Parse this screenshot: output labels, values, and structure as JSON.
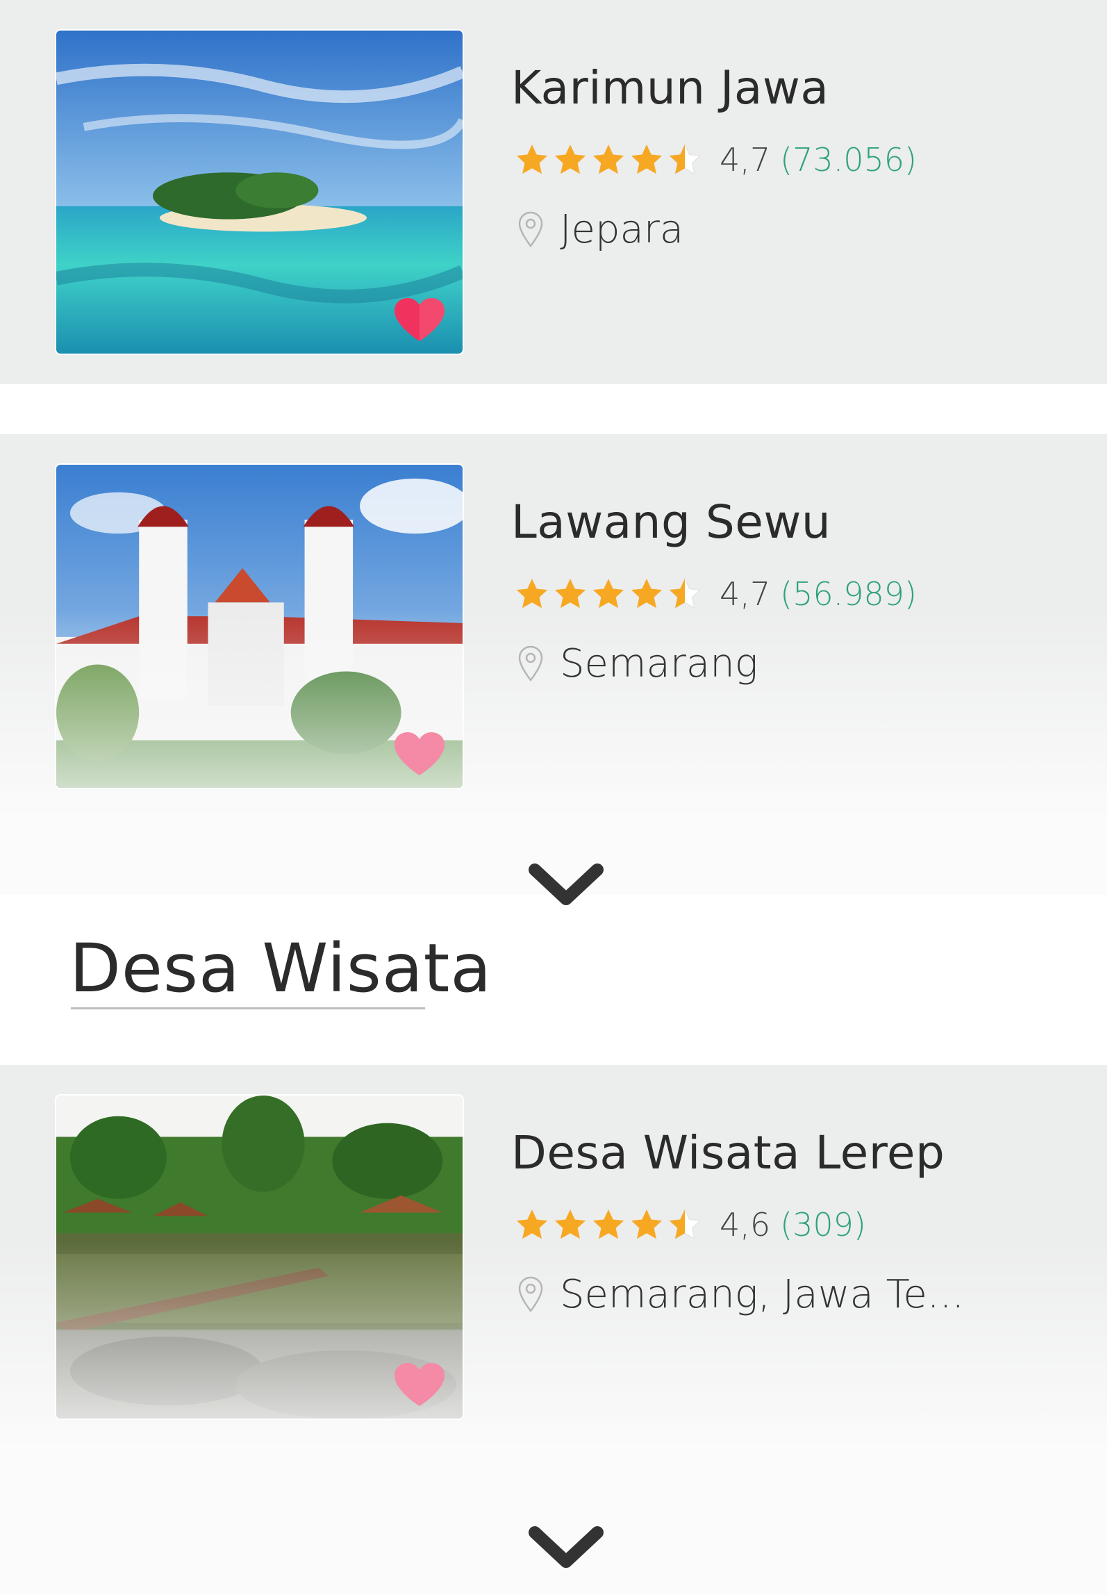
{
  "cards": [
    {
      "title": "Karimun Jawa",
      "rating": "4,7",
      "count": "(73.056)",
      "location": "Jepara",
      "stars_value": 4.5,
      "image_alt": "tropical-island-photo",
      "favorite_color": "#f0325e"
    },
    {
      "title": "Lawang Sewu",
      "rating": "4,7",
      "count": "(56.989)",
      "location": "Semarang",
      "stars_value": 4.5,
      "image_alt": "colonial-building-photo",
      "favorite_color": "#f48aa5"
    },
    {
      "title": "Desa Wisata Lerep",
      "rating": "4,6",
      "count": "(309)",
      "location": "Semarang, Jawa Te...",
      "stars_value": 4.5,
      "image_alt": "village-lake-photo",
      "favorite_color": "#f48aa5"
    }
  ],
  "section": {
    "title": "Desa Wisata"
  },
  "icons": {
    "star": "star-icon",
    "half_star": "half-star-icon",
    "pin": "location-pin-icon",
    "heart": "heart-icon",
    "chevron": "chevron-down-icon"
  },
  "colors": {
    "card_bg": "#eceded",
    "star": "#f7a823",
    "review_count": "#2fa27a",
    "title_text": "#2b2b2b"
  }
}
